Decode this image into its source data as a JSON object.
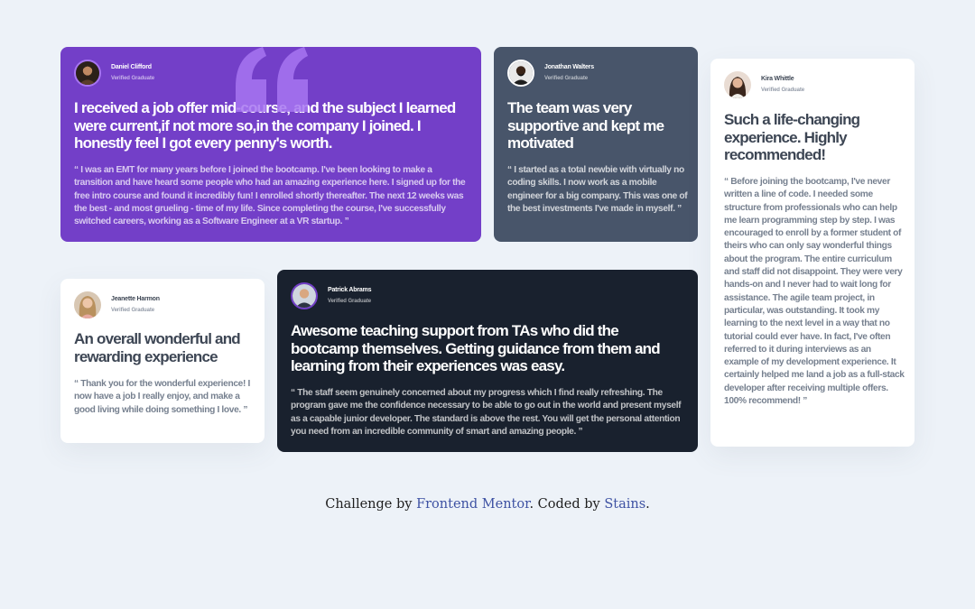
{
  "testimonials": [
    {
      "name": "Daniel Clifford",
      "status": "Verified Graduate",
      "headline": "I received a job offer mid-course, and the subject I learned were current,if not more so,in the company I joined. I honestly feel I got every penny's worth.",
      "body": "“ I was an EMT for many years before I joined the bootcamp. I've been looking to make a transition and have heard some people who had an amazing experience here. I signed up for the free intro course and found it incredibly fun! I enrolled shortly thereafter. The next 12 weeks was the best - and most grueling - time of my life. Since completing the course, I've successfully switched careers, working as a Software Engineer at a VR startup. ”"
    },
    {
      "name": "Jonathan Walters",
      "status": "Verified Graduate",
      "headline": "The team was very supportive and kept me motivated",
      "body": "“ I started as a total newbie with virtually no coding skills. I now work as a mobile engineer for a big company. This was one of the best investments I've made in myself. ”"
    },
    {
      "name": "Kira Whittle",
      "status": "Verified Graduate",
      "headline": "Such a life-changing experience. Highly recommended!",
      "body": "“ Before joining the bootcamp, I've never written a line of code. I needed some structure from professionals who can help me learn programming step by step. I was encouraged to enroll by a former student of theirs who can only say wonderful things about the program. The entire curriculum and staff did not disappoint. They were very hands-on and I never had to wait long for assistance. The agile team project, in particular, was outstanding. It took my learning to the next level in a way that no tutorial could ever have. In fact, I've often referred to it during interviews as an example of my development experience. It certainly helped me land a job as a full-stack developer after receiving multiple offers. 100% recommend! ”"
    },
    {
      "name": "Jeanette Harmon",
      "status": "Verified Graduate",
      "headline": "An overall wonderful and rewarding experience",
      "body": "“ Thank you for the wonderful experience! I now have a job I really enjoy, and make a good living while doing something I love. ”"
    },
    {
      "name": "Patrick Abrams",
      "status": "Verified Graduate",
      "headline": "Awesome teaching support from TAs who did the bootcamp themselves. Getting guidance from them and learning from their experiences was easy.",
      "body": "“ The staff seem genuinely concerned about my progress which I find really refreshing. The program gave me the confidence necessary to be able to go out in the world and present myself as a capable junior developer. The standard is above the rest. You will get the personal attention you need from an incredible community of smart and amazing people. ”"
    }
  ],
  "footer": {
    "prefix": "Challenge by",
    "link1": "Frontend Mentor",
    "middle": ". Coded by",
    "link2": "Stains",
    "suffix": "."
  },
  "colors": {
    "purple": "#733fc8",
    "grayish_blue": "#48556a",
    "dark_blackish_blue": "#19212e",
    "background": "#edf2f8",
    "white": "#ffffff"
  },
  "icons": [
    "quotation-icon"
  ]
}
